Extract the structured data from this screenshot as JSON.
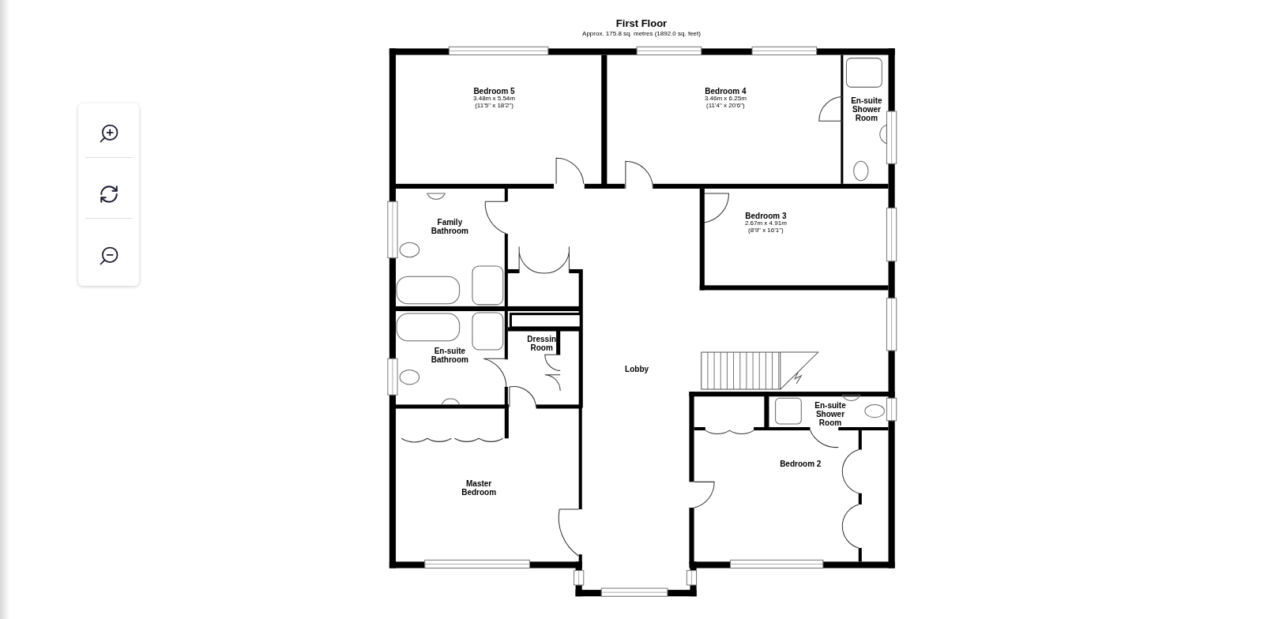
{
  "floor_plan": {
    "title": "First Floor",
    "subtitle": "Approx. 175.8 sq. metres (1892.0 sq. feet)",
    "rooms": [
      {
        "name": "Bedroom 5",
        "metric": "3.48m x 5.54m",
        "imperial": "(11'5\" x 18'2\")"
      },
      {
        "name": "Bedroom 4",
        "metric": "3.46m x 6.25m",
        "imperial": "(11'4\" x 20'6\")"
      },
      {
        "name": "En-suite Shower Room"
      },
      {
        "name": "Family Bathroom"
      },
      {
        "name": "Bedroom 3",
        "metric": "2.67m x 4.91m",
        "imperial": "(8'9\" x 16'1\")"
      },
      {
        "name": "Dressin Room"
      },
      {
        "name": "En-suite Bathroom"
      },
      {
        "name": "Lobby"
      },
      {
        "name": "En-suite Shower Room"
      },
      {
        "name": "Bedroom 2"
      },
      {
        "name": "Master Bedroom"
      }
    ]
  }
}
